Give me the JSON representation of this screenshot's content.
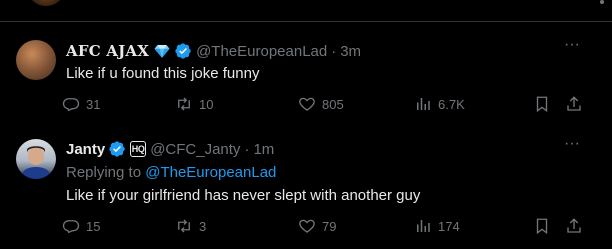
{
  "tweets": [
    {
      "display_name": "AFC AJAX",
      "handle": "@TheEuropeanLad",
      "separator": "·",
      "time": "3m",
      "text": "Like if u found this joke funny",
      "reply_count": "31",
      "retweet_count": "10",
      "like_count": "805",
      "view_count": "6.7K",
      "more_label": "···"
    },
    {
      "display_name": "Janty",
      "badge_label": "HQ",
      "handle": "@CFC_Janty",
      "separator": "·",
      "time": "1m",
      "replying_prefix": "Replying to",
      "replying_mention": "@TheEuropeanLad",
      "text": "Like if your girlfriend has never slept with another guy",
      "reply_count": "15",
      "retweet_count": "3",
      "like_count": "79",
      "view_count": "174",
      "more_label": "···"
    }
  ],
  "colors": {
    "background": "#000000",
    "primary_text": "#e7e9ea",
    "secondary_text": "#71767b",
    "accent": "#1d9bf0",
    "divider": "#2f3336"
  },
  "icons": [
    "reply-icon",
    "retweet-icon",
    "like-icon",
    "views-icon",
    "bookmark-icon",
    "share-icon",
    "verified-icon",
    "diamond-icon",
    "more-icon"
  ]
}
